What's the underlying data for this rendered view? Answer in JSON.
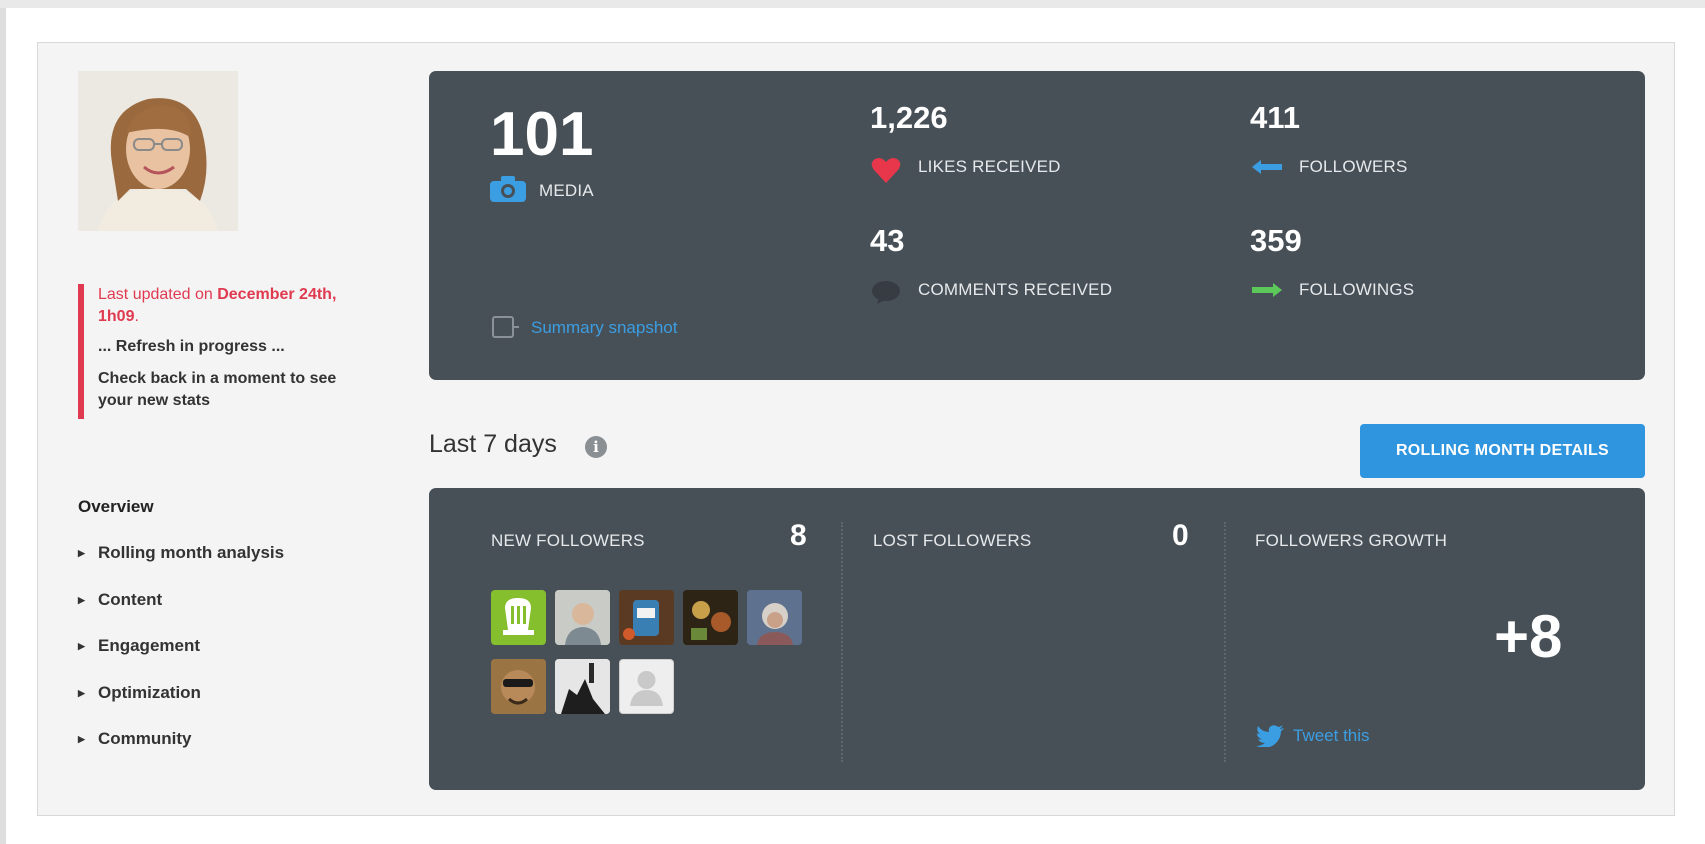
{
  "status": {
    "updated_prefix": "Last updated on ",
    "updated_date": "December 24th, 1h09",
    "updated_suffix": ".",
    "refresh": "... Refresh in progress ...",
    "check_back": "Check back in a moment to see your new stats"
  },
  "nav": {
    "title": "Overview",
    "items": [
      "Rolling month analysis",
      "Content",
      "Engagement",
      "Optimization",
      "Community"
    ]
  },
  "summary": {
    "media_count": "101",
    "media_label": "MEDIA",
    "likes_count": "1,226",
    "likes_label": "LIKES RECEIVED",
    "comments_count": "43",
    "comments_label": "COMMENTS RECEIVED",
    "followers_count": "411",
    "followers_label": "FOLLOWERS",
    "followings_count": "359",
    "followings_label": "FOLLOWINGS",
    "snapshot_link": "Summary snapshot"
  },
  "period": {
    "title": "Last 7 days",
    "button": "ROLLING MONTH DETAILS"
  },
  "weekly": {
    "new_followers_label": "NEW FOLLOWERS",
    "new_followers_count": "8",
    "lost_followers_label": "LOST FOLLOWERS",
    "lost_followers_count": "0",
    "growth_label": "FOLLOWERS GROWTH",
    "growth_value": "+8",
    "tweet_link": "Tweet this"
  },
  "colors": {
    "card_bg": "#485057",
    "accent_blue": "#2f95df",
    "alert_red": "#e03a50",
    "heart_red": "#e8374a",
    "following_green": "#5cc85a"
  },
  "icons": [
    "camera-icon",
    "heart-icon",
    "comment-icon",
    "arrow-left-icon",
    "arrow-right-icon",
    "snapshot-icon",
    "info-icon",
    "twitter-icon"
  ]
}
